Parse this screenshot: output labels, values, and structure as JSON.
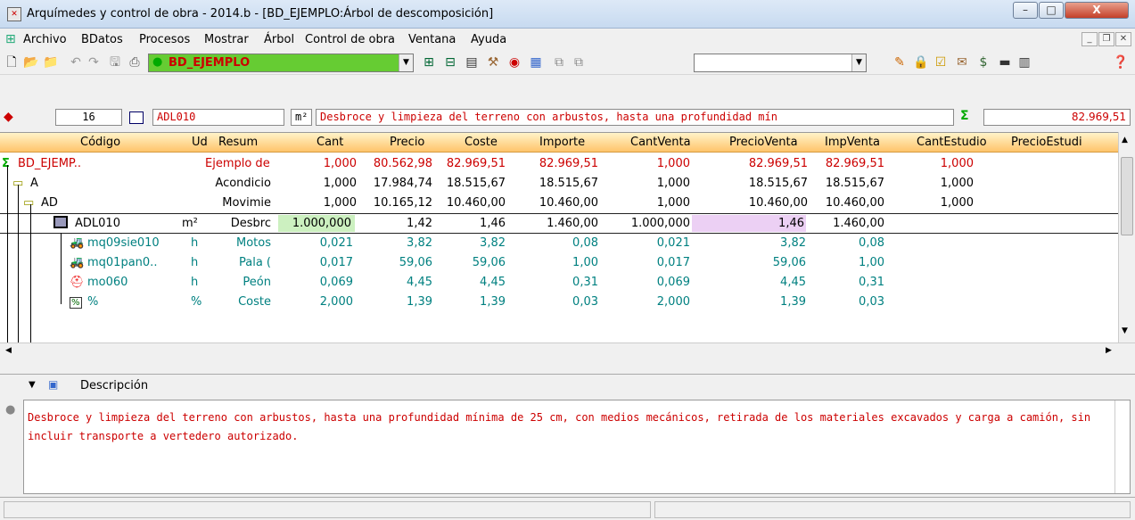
{
  "window": {
    "title": "Arquímedes y control de obra - 2014.b - [BD_EJEMPLO:Árbol de descomposición]",
    "min": "–",
    "max": "□",
    "close": "X"
  },
  "menu": [
    "Archivo",
    "BDatos",
    "Procesos",
    "Mostrar",
    "Árbol",
    "Control de obra",
    "Ventana",
    "Ayuda"
  ],
  "toolbar": {
    "database": "BD_EJEMPLO",
    "search_value": ""
  },
  "infobar": {
    "level": "16",
    "code": "ADL010",
    "unit": "m²",
    "summary": "Desbroce y limpieza del terreno con arbustos, hasta una profundidad mín",
    "total": "82.969,51"
  },
  "grid": {
    "columns": [
      "Código",
      "Ud",
      "Resum",
      "Cant",
      "Precio",
      "Coste",
      "Importe",
      "CantVenta",
      "PrecioVenta",
      "ImpVenta",
      "CantEstudio",
      "PrecioEstudi"
    ],
    "rows": [
      {
        "code": "BD_EJEMP..",
        "ud": "",
        "resum": "Ejemplo de",
        "cant": "1,000",
        "precio": "80.562,98",
        "coste": "82.969,51",
        "importe": "82.969,51",
        "cantventa": "1,000",
        "precioventa": "82.969,51",
        "impventa": "82.969,51",
        "cantestudio": "1,000"
      },
      {
        "code": "A",
        "ud": "",
        "resum": "Acondicio",
        "cant": "1,000",
        "precio": "17.984,74",
        "coste": "18.515,67",
        "importe": "18.515,67",
        "cantventa": "1,000",
        "precioventa": "18.515,67",
        "impventa": "18.515,67",
        "cantestudio": "1,000"
      },
      {
        "code": "AD",
        "ud": "",
        "resum": "Movimie",
        "cant": "1,000",
        "precio": "10.165,12",
        "coste": "10.460,00",
        "importe": "10.460,00",
        "cantventa": "1,000",
        "precioventa": "10.460,00",
        "impventa": "10.460,00",
        "cantestudio": "1,000"
      },
      {
        "code": "ADL010",
        "ud": "m²",
        "resum": "Desbrc",
        "cant": "1.000,000",
        "precio": "1,42",
        "coste": "1,46",
        "importe": "1.460,00",
        "cantventa": "1.000,000",
        "precioventa": "1,46",
        "impventa": "1.460,00",
        "cantestudio": ""
      },
      {
        "code": "mq09sie010",
        "ud": "h",
        "resum": "Motos",
        "cant": "0,021",
        "precio": "3,82",
        "coste": "3,82",
        "importe": "0,08",
        "cantventa": "0,021",
        "precioventa": "3,82",
        "impventa": "0,08",
        "cantestudio": ""
      },
      {
        "code": "mq01pan0..",
        "ud": "h",
        "resum": "Pala (",
        "cant": "0,017",
        "precio": "59,06",
        "coste": "59,06",
        "importe": "1,00",
        "cantventa": "0,017",
        "precioventa": "59,06",
        "impventa": "1,00",
        "cantestudio": ""
      },
      {
        "code": "mo060",
        "ud": "h",
        "resum": "Peón",
        "cant": "0,069",
        "precio": "4,45",
        "coste": "4,45",
        "importe": "0,31",
        "cantventa": "0,069",
        "precioventa": "4,45",
        "impventa": "0,31",
        "cantestudio": ""
      },
      {
        "code": "%",
        "ud": "%",
        "resum": "Coste",
        "cant": "2,000",
        "precio": "1,39",
        "coste": "1,39",
        "importe": "0,03",
        "cantventa": "2,000",
        "precioventa": "1,39",
        "impventa": "0,03",
        "cantestudio": ""
      }
    ]
  },
  "description": {
    "header": "Descripción",
    "text": "Desbroce y limpieza del terreno con arbustos, hasta una profundidad mínima de 25 cm, con medios mecánicos, retirada de los materiales excavados y carga a camión, sin incluir transporte a vertedero autorizado."
  }
}
